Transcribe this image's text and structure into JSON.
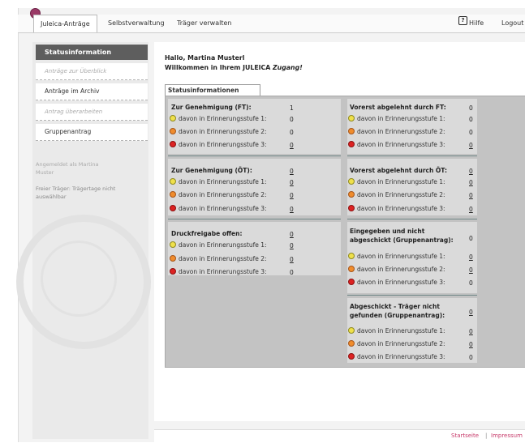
{
  "header": {
    "nav_active": "Juleica-Anträge",
    "nav_items": [
      "Selbstverwaltung",
      "Träger verwalten"
    ],
    "help_label": "Hilfe",
    "logout_label": "Logout"
  },
  "sidebar": {
    "heading": "Statusinformation",
    "items": [
      {
        "label": "Anträge zur Überblick"
      },
      {
        "label": "Anträge im Archiv"
      },
      {
        "label": "Antrag überarbeiten"
      },
      {
        "label": "Gruppenantrag"
      }
    ],
    "note_user": "Angemeldet als Martina Muster",
    "note_notice": "Freier Träger: Trägertage nicht auswählbar"
  },
  "greeting": {
    "line1": "Hallo, Martina Musterl",
    "line2": "Willkommen in Ihrem JULEICA ",
    "line2_em": "Zugang!"
  },
  "status": {
    "tab": "Statusinformationen",
    "left": [
      {
        "title": "Zur Genehmigung (FT):",
        "value": "1",
        "rows": [
          {
            "label": "davon in Erinnerungsstufe 1:",
            "value": "0"
          },
          {
            "label": "davon in Erinnerungsstufe 2:",
            "value": "0"
          },
          {
            "label": "davon in Erinnerungsstufe 3:",
            "value": "0"
          }
        ]
      },
      {
        "title": "Zur Genehmigung (ÖT):",
        "value": "0",
        "rows": [
          {
            "label": "davon in Erinnerungsstufe 1:",
            "value": "0"
          },
          {
            "label": "davon in Erinnerungsstufe 2:",
            "value": "0"
          },
          {
            "label": "davon in Erinnerungsstufe 3:",
            "value": "0"
          }
        ]
      },
      {
        "title": "Druckfreigabe offen:",
        "value": "0",
        "rows": [
          {
            "label": "davon in Erinnerungsstufe 1:",
            "value": "0"
          },
          {
            "label": "davon in Erinnerungsstufe 2:",
            "value": "0"
          },
          {
            "label": "davon in Erinnerungsstufe 3:",
            "value": "0"
          }
        ]
      }
    ],
    "right": [
      {
        "title": "Vorerst abgelehnt durch FT:",
        "value": "0",
        "rows": [
          {
            "label": "davon in Erinnerungsstufe 1:",
            "value": "0"
          },
          {
            "label": "davon in Erinnerungsstufe 2:",
            "value": "0"
          },
          {
            "label": "davon in Erinnerungsstufe 3:",
            "value": "0"
          }
        ]
      },
      {
        "title": "Vorerst abgelehnt durch ÖT:",
        "value": "0",
        "rows": [
          {
            "label": "davon in Erinnerungsstufe 1:",
            "value": "0"
          },
          {
            "label": "davon in Erinnerungsstufe 2:",
            "value": "0"
          },
          {
            "label": "davon in Erinnerungsstufe 3:",
            "value": "0"
          }
        ]
      },
      {
        "title": "Eingegeben und nicht abgeschickt (Gruppenantrag):",
        "value": "0",
        "rows": [
          {
            "label": "davon in Erinnerungsstufe 1:",
            "value": "0"
          },
          {
            "label": "davon in Erinnerungsstufe 2:",
            "value": "0"
          },
          {
            "label": "davon in Erinnerungsstufe 3:",
            "value": "0"
          }
        ]
      },
      {
        "title": "Abgeschickt - Träger nicht gefunden (Gruppenantrag):",
        "value": "0",
        "rows": [
          {
            "label": "davon in Erinnerungsstufe 1:",
            "value": "0"
          },
          {
            "label": "davon in Erinnerungsstufe 2:",
            "value": "0"
          },
          {
            "label": "davon in Erinnerungsstufe 3:",
            "value": "0"
          }
        ]
      }
    ]
  },
  "footer": {
    "startseite": "Startseite",
    "divider": "|",
    "impressum": "Impressum"
  },
  "colors": {
    "accent": "#c73a6a",
    "level1": "#efe04a",
    "level2": "#f08c2c",
    "level3": "#dd2222"
  }
}
